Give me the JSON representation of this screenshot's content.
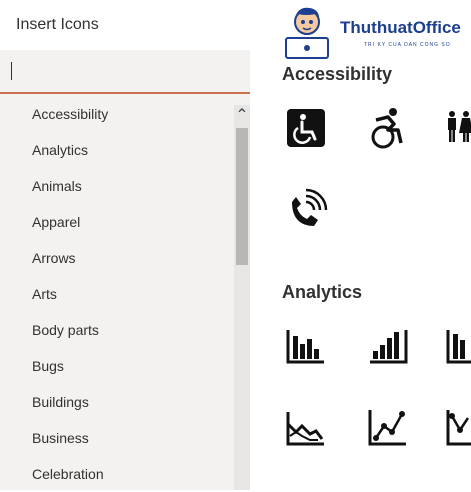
{
  "dialog": {
    "title": "Insert Icons"
  },
  "search": {
    "value": ""
  },
  "categories": [
    {
      "label": "Accessibility"
    },
    {
      "label": "Analytics"
    },
    {
      "label": "Animals"
    },
    {
      "label": "Apparel"
    },
    {
      "label": "Arrows"
    },
    {
      "label": "Arts"
    },
    {
      "label": "Body parts"
    },
    {
      "label": "Bugs"
    },
    {
      "label": "Buildings"
    },
    {
      "label": "Business"
    },
    {
      "label": "Celebration"
    }
  ],
  "sections": [
    {
      "title": "Accessibility",
      "icons": [
        "wheelchair-sign-icon",
        "active-wheelchair-icon",
        "restroom-icon",
        "tty-phone-icon"
      ]
    },
    {
      "title": "Analytics",
      "icons": [
        "bar-chart-icon",
        "bar-chart-ascending-icon",
        "bar-chart-partial-icon",
        "line-chart-down-icon",
        "line-chart-up-icon",
        "line-chart-partial-icon"
      ]
    }
  ],
  "watermark": {
    "brand": "ThuthuatOffice",
    "tagline": "TRI KY CUA DAN CONG SO"
  },
  "colors": {
    "accent": "#c8704d",
    "brand": "#1c3f8f",
    "pane": "#f3f2f1"
  }
}
